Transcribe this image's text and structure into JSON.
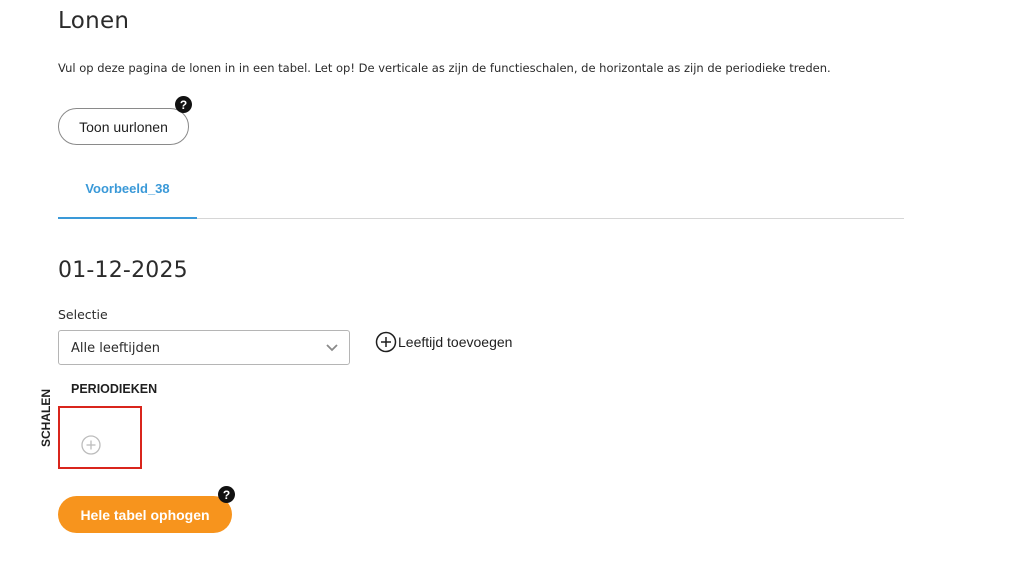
{
  "page": {
    "title": "Lonen",
    "intro": "Vul op deze pagina de lonen in in een tabel. Let op! De verticale as zijn de functieschalen, de horizontale as zijn de periodieke treden."
  },
  "actions": {
    "show_hourly_label": "Toon uurlonen",
    "help_glyph": "?"
  },
  "tabs": [
    {
      "label": "Voorbeeld_38",
      "active": true
    }
  ],
  "section": {
    "date": "01-12-2025",
    "selection_label": "Selectie",
    "selection_value": "Alle leeftijden",
    "add_age_label": "Leeftijd toevoegen"
  },
  "table": {
    "row_axis_label": "SCHALEN",
    "col_axis_label": "PERIODIEKEN"
  },
  "footer": {
    "raise_table_label": "Hele tabel ophogen"
  },
  "icons": {
    "help": "question-circle-icon",
    "add": "plus-circle-icon",
    "dropdown": "chevron-down-icon"
  },
  "colors": {
    "accent_blue": "#3a99d8",
    "accent_orange": "#f7941d",
    "highlight_red": "#d9251c"
  }
}
